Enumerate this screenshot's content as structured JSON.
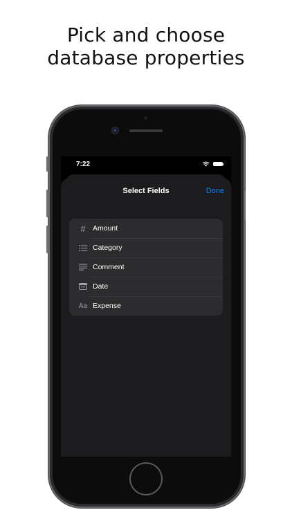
{
  "headline": {
    "line1": "Pick and choose",
    "line2": "database properties"
  },
  "status_bar": {
    "time": "7:22"
  },
  "sheet": {
    "title": "Select Fields",
    "done_label": "Done"
  },
  "fields": [
    {
      "icon": "hash-icon",
      "glyph": "#",
      "label": "Amount"
    },
    {
      "icon": "list-icon",
      "label": "Category"
    },
    {
      "icon": "text-lines-icon",
      "label": "Comment"
    },
    {
      "icon": "calendar-icon",
      "label": "Date"
    },
    {
      "icon": "text-type-icon",
      "glyph": "Aa",
      "label": "Expense"
    }
  ],
  "colors": {
    "accent": "#0a84ff",
    "sheet_bg": "#1c1c1e",
    "row_bg": "#2c2c2e"
  }
}
